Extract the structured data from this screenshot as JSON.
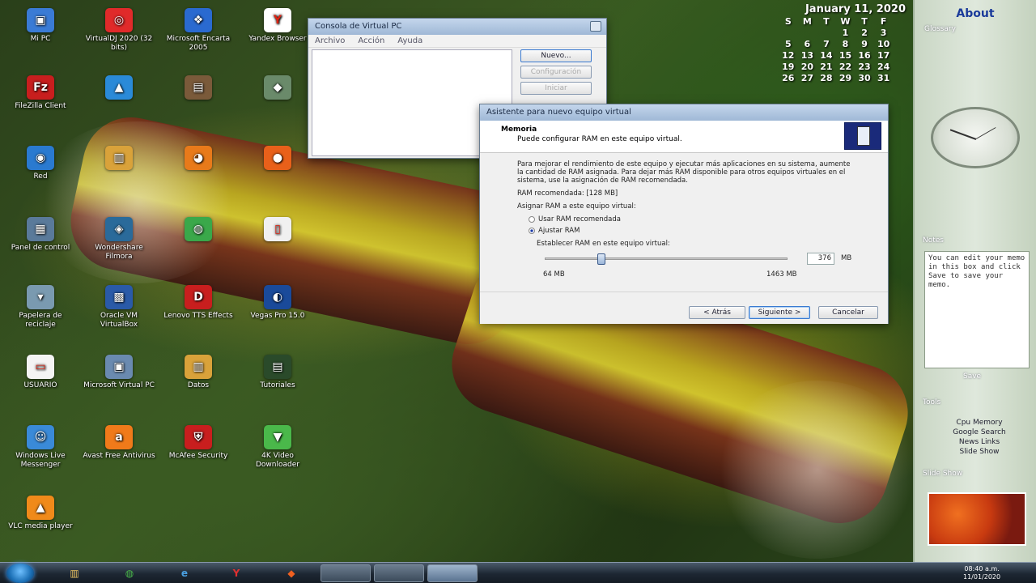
{
  "desktop_icons": [
    {
      "label": "Mi PC",
      "color": "#3a7bd5",
      "glyph": "▣",
      "name": "mi-pc-icon"
    },
    {
      "label": "VirtualDJ 2020 (32 bits)",
      "color": "#e02a2a",
      "glyph": "◎",
      "name": "virtualdj-icon"
    },
    {
      "label": "Microsoft Encarta 2005",
      "color": "#2a6ad0",
      "glyph": "❖",
      "name": "encarta-icon"
    },
    {
      "label": "Yandex Browser",
      "color": "#ffffff",
      "glyph": "Y",
      "name": "yandex-icon"
    },
    {
      "label": "FileZilla Client",
      "color": "#c81e1e",
      "glyph": "Fz",
      "name": "filezilla-icon"
    },
    {
      "label": "",
      "color": "#2a8ad8",
      "glyph": "▲",
      "name": "app-icon"
    },
    {
      "label": "",
      "color": "#7a5a3a",
      "glyph": "▤",
      "name": "book-icon"
    },
    {
      "label": "",
      "color": "#6a8a6a",
      "glyph": "◆",
      "name": "tool-icon"
    },
    {
      "label": "Red",
      "color": "#2a7ad0",
      "glyph": "◉",
      "name": "red-icon"
    },
    {
      "label": "",
      "color": "#d9a23a",
      "glyph": "▥",
      "name": "folder-icon"
    },
    {
      "label": "",
      "color": "#e87a1a",
      "glyph": "◕",
      "name": "app2-icon"
    },
    {
      "label": "",
      "color": "#e8601a",
      "glyph": "●",
      "name": "firefox-icon"
    },
    {
      "label": "Panel de control",
      "color": "#5a7a9a",
      "glyph": "▦",
      "name": "panel-control-icon"
    },
    {
      "label": "Wondershare Filmora",
      "color": "#2a6a9a",
      "glyph": "◈",
      "name": "filmora-icon"
    },
    {
      "label": "",
      "color": "#3aa84a",
      "glyph": "◍",
      "name": "chrome-icon"
    },
    {
      "label": "",
      "color": "#f0f0f0",
      "glyph": "▯",
      "name": "file-icon"
    },
    {
      "label": "Papelera de reciclaje",
      "color": "#7a9ab0",
      "glyph": "▾",
      "name": "recycle-bin-icon"
    },
    {
      "label": "Oracle VM VirtualBox",
      "color": "#2a5aa8",
      "glyph": "▩",
      "name": "virtualbox-icon"
    },
    {
      "label": "Lenovo TTS Effects",
      "color": "#c81e1e",
      "glyph": "D",
      "name": "lenovo-icon"
    },
    {
      "label": "Vegas Pro 15.0",
      "color": "#1a4a9a",
      "glyph": "◐",
      "name": "vegas-icon"
    },
    {
      "label": "USUARIO",
      "color": "#f4f4f4",
      "glyph": "▭",
      "name": "usuario-icon"
    },
    {
      "label": "Microsoft Virtual PC",
      "color": "#6a8ab0",
      "glyph": "▣",
      "name": "virtual-pc-icon"
    },
    {
      "label": "Datos",
      "color": "#d9a23a",
      "glyph": "▥",
      "name": "datos-icon"
    },
    {
      "label": "Tutoriales",
      "color": "#2a4a2a",
      "glyph": "▤",
      "name": "tutoriales-icon"
    },
    {
      "label": "Windows Live Messenger",
      "color": "#3a8ad8",
      "glyph": "☺",
      "name": "messenger-icon"
    },
    {
      "label": "Avast Free Antivirus",
      "color": "#f07a1a",
      "glyph": "a",
      "name": "avast-icon"
    },
    {
      "label": "McAfee Security",
      "color": "#c81e1e",
      "glyph": "⛨",
      "name": "mcafee-icon"
    },
    {
      "label": "4K Video Downloader",
      "color": "#4ab84a",
      "glyph": "▼",
      "name": "4k-video-icon"
    },
    {
      "label": "VLC media player",
      "color": "#f08a1a",
      "glyph": "▲",
      "name": "vlc-icon"
    }
  ],
  "calendar": {
    "title": "January 11, 2020",
    "weekdays": [
      "S",
      "M",
      "T",
      "W",
      "T",
      "F"
    ],
    "rows": [
      [
        "",
        "",
        "",
        "1",
        "2",
        "3"
      ],
      [
        "5",
        "6",
        "7",
        "8",
        "9",
        "10"
      ],
      [
        "12",
        "13",
        "14",
        "15",
        "16",
        "17"
      ],
      [
        "19",
        "20",
        "21",
        "22",
        "23",
        "24"
      ],
      [
        "26",
        "27",
        "28",
        "29",
        "30",
        "31"
      ]
    ]
  },
  "sidebar": {
    "title": "About",
    "link": "Glossary",
    "notes_label": "Notes",
    "notes_text": "You can edit your memo in this box and click Save to save your memo.",
    "notes_save": "Save",
    "tools_label": "Tools",
    "tools": [
      "Cpu Memory",
      "Google Search",
      "News Links",
      "Slide Show"
    ],
    "slide_label": "Slide Show"
  },
  "console": {
    "title": "Consola de Virtual PC",
    "menu": [
      "Archivo",
      "Acción",
      "Ayuda"
    ],
    "buttons": [
      "Nuevo...",
      "Configuración",
      "Iniciar"
    ]
  },
  "wizard": {
    "title": "Asistente para nuevo equipo virtual",
    "heading": "Memoria",
    "subheading": "Puede configurar RAM en este equipo virtual.",
    "description": "Para mejorar el rendimiento de este equipo y ejecutar más aplicaciones en su sistema, aumente la cantidad de RAM asignada. Para dejar más RAM disponible para otros equipos virtuales en el sistema, use la asignación de RAM recomendada.",
    "recommended": "RAM recomendada: [128 MB]",
    "assign_label": "Asignar RAM a este equipo virtual:",
    "option_recommended": "Usar RAM recomendada",
    "option_adjust": "Ajustar RAM",
    "set_label": "Establecer RAM en este equipo virtual:",
    "ram_value": "376",
    "ram_unit": "MB",
    "slider_min": "64 MB",
    "slider_max": "1463 MB",
    "slider_fraction": 0.22,
    "back": "< Atrás",
    "next": "Siguiente >",
    "cancel": "Cancelar"
  },
  "taskbar": {
    "time": "08:40 a.m.",
    "date": "11/01/2020"
  }
}
